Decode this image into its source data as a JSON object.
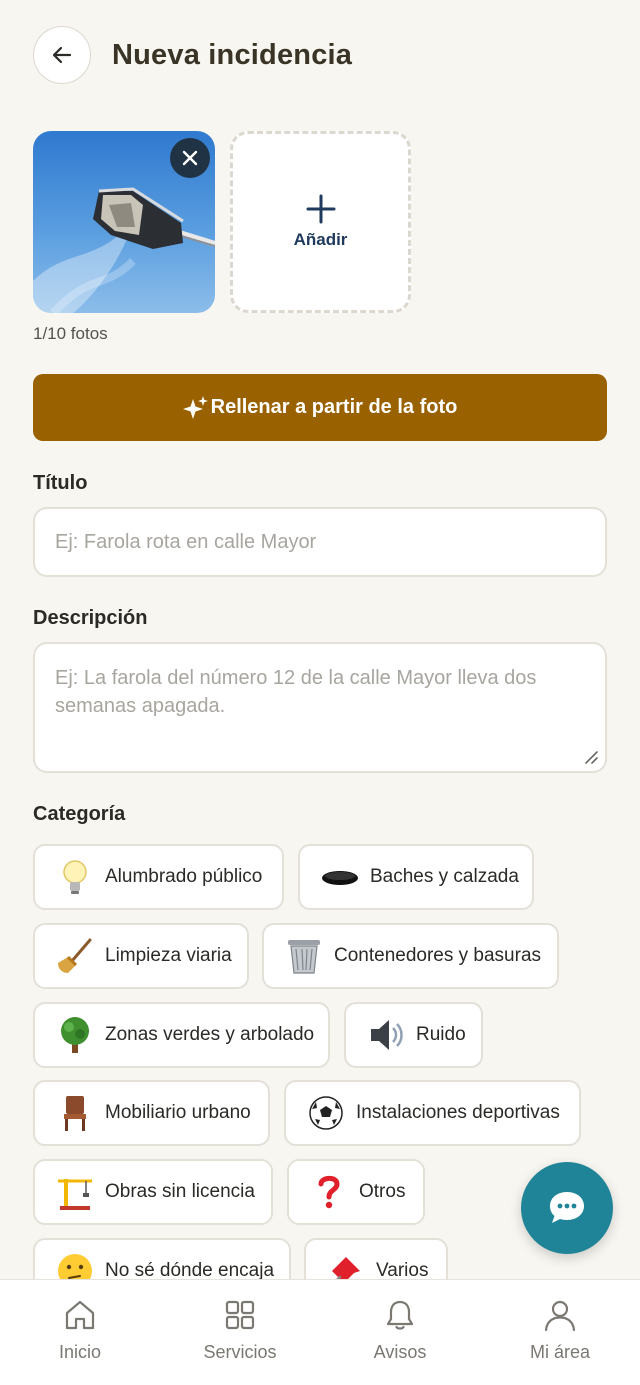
{
  "header": {
    "title": "Nueva incidencia"
  },
  "photos": {
    "add_label": "Añadir",
    "count_text": "1/10 fotos"
  },
  "fill_button": {
    "label": "Rellenar a partir de la foto"
  },
  "form": {
    "title_label": "Título",
    "title_placeholder": "Ej: Farola rota en calle Mayor",
    "description_label": "Descripción",
    "description_placeholder": "Ej: La farola del número 12 de la calle Mayor lleva dos semanas apagada.",
    "category_label": "Categoría"
  },
  "categories": [
    {
      "label": "Alumbrado público",
      "icon": "lightbulb-icon"
    },
    {
      "label": "Baches y calzada",
      "icon": "hole-icon"
    },
    {
      "label": "Limpieza viaria",
      "icon": "broom-icon"
    },
    {
      "label": "Contenedores y basuras",
      "icon": "wastebasket-icon"
    },
    {
      "label": "Zonas verdes y arbolado",
      "icon": "tree-icon"
    },
    {
      "label": "Ruido",
      "icon": "speaker-icon"
    },
    {
      "label": "Mobiliario urbano",
      "icon": "chair-icon"
    },
    {
      "label": "Instalaciones deportivas",
      "icon": "soccer-ball-icon"
    },
    {
      "label": "Obras sin licencia",
      "icon": "crane-icon"
    },
    {
      "label": "Otros",
      "icon": "question-mark-icon"
    },
    {
      "label": "No sé dónde encaja",
      "icon": "thinking-face-icon"
    },
    {
      "label": "Varios",
      "icon": "pushpin-icon"
    }
  ],
  "bottom_nav": {
    "items": [
      {
        "label": "Inicio",
        "icon": "home-icon"
      },
      {
        "label": "Servicios",
        "icon": "grid-icon"
      },
      {
        "label": "Avisos",
        "icon": "bell-icon"
      },
      {
        "label": "Mi área",
        "icon": "user-icon"
      }
    ]
  },
  "colors": {
    "background": "#f8f6f1",
    "accent_button": "#9a6100",
    "fab": "#1f8497",
    "title_text": "#3a3426"
  }
}
